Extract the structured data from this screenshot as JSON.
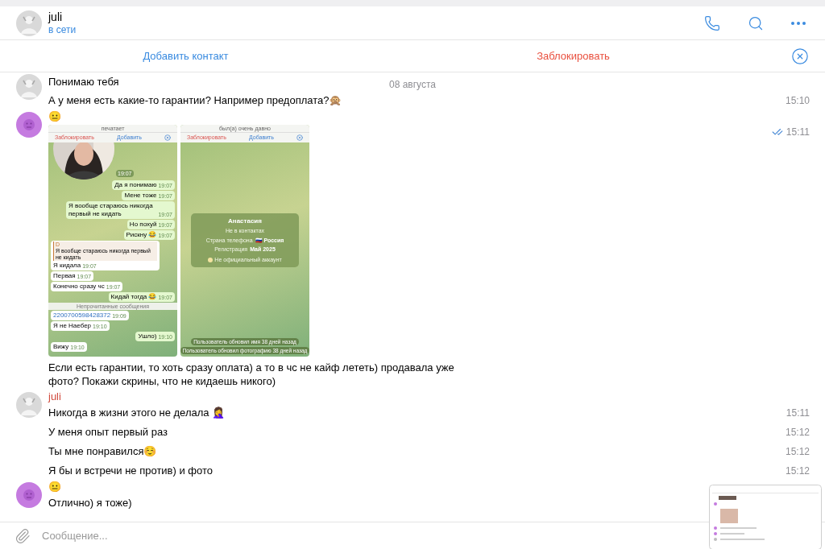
{
  "top_bar": {
    "name": "juli",
    "status": "в сети"
  },
  "action_bar": {
    "add_contact": "Добавить контакт",
    "block": "Заблокировать"
  },
  "date": "08 августа",
  "groups": [
    {
      "messages": [
        {
          "kind": "text",
          "text": "Понимаю тебя"
        },
        {
          "kind": "text",
          "text": "А у меня есть какие-то гарантии? Например предоплата?🙊",
          "time": "15:10"
        }
      ]
    },
    {
      "avatar": {
        "kind": "emoji"
      },
      "sender": "😐",
      "messages": [
        {
          "kind": "screenshots",
          "time": "15:11",
          "read": true,
          "images": [
            {
              "kind": "chat",
              "status": "печатает",
              "block": "Заблокировать",
              "add": "Добавить",
              "video_time": "19:07",
              "bubbles": [
                {
                  "kind": "out",
                  "text": "Да я понимаю",
                  "time": "19:07"
                },
                {
                  "kind": "out",
                  "text": "Мене тоже",
                  "time": "19:07"
                },
                {
                  "kind": "out",
                  "text": "Я вообще стараюсь никогда первый не кидать",
                  "time": "19:07"
                },
                {
                  "kind": "out",
                  "text": "Но похуй",
                  "time": "19:07"
                },
                {
                  "kind": "out",
                  "text": "Рискну 😂",
                  "time": "19:07"
                },
                {
                  "kind": "in",
                  "reply": {
                    "author": "D",
                    "text": "Я вообще стараюсь никогда первый не кидать"
                  },
                  "text": "Я кидала",
                  "time": "19:07"
                },
                {
                  "kind": "in",
                  "text": "Первая",
                  "time": "19:07"
                },
                {
                  "kind": "in",
                  "text": "Конечно сразу чс",
                  "time": "19:07"
                },
                {
                  "kind": "out",
                  "text": "Кидай тогда 😂",
                  "time": "19:07"
                },
                {
                  "kind": "divider",
                  "text": "Непрочитанные сообщения"
                },
                {
                  "kind": "in",
                  "link": true,
                  "text": "2200700598428372",
                  "time": "19:09"
                },
                {
                  "kind": "in",
                  "text": "Я не Наебер",
                  "time": "19:10"
                },
                {
                  "kind": "out",
                  "text": "Ушло)",
                  "time": "19:10"
                },
                {
                  "kind": "in",
                  "text": "Вижу",
                  "time": "19:10"
                }
              ]
            },
            {
              "kind": "profile",
              "status": "был(а) очень давно",
              "block": "Заблокировать",
              "add": "Добавить",
              "card": {
                "name": "Анастасия",
                "subtitle": "Не в контактах",
                "rows": [
                  {
                    "label": "Страна телефона",
                    "value": "🇷🇺 Россия"
                  },
                  {
                    "label": "Регистрация",
                    "value": "Май 2025"
                  }
                ],
                "note": "Не официальный аккаунт"
              },
              "notices": [
                "Пользователь обновил имя 38 дней назад",
                "Пользователь обновил фотографию 38 дней назад"
              ]
            }
          ]
        },
        {
          "kind": "text",
          "text": "Если есть гарантии, то хоть сразу оплата) а то в чс не кайф лететь) продавала уже фото? Покажи скрины, что не кидаешь никого)"
        }
      ]
    },
    {
      "sender": "juli",
      "color": "#d14a3d",
      "messages": [
        {
          "kind": "text",
          "text": "Никогда в жизни этого не делала 🤦‍♀️",
          "time": "15:11"
        },
        {
          "kind": "text",
          "text": "У меня опыт первый раз",
          "time": "15:12"
        },
        {
          "kind": "text",
          "text": "Ты мне понравился☺️",
          "time": "15:12"
        },
        {
          "kind": "text",
          "text": "Я бы и встречи не против) и фото",
          "time": "15:12"
        }
      ]
    },
    {
      "avatar": {
        "kind": "emoji"
      },
      "sender": "😐",
      "messages": [
        {
          "kind": "text",
          "text": "Отлично) я тоже)"
        }
      ]
    }
  ],
  "composer": {
    "placeholder": "Сообщение..."
  }
}
